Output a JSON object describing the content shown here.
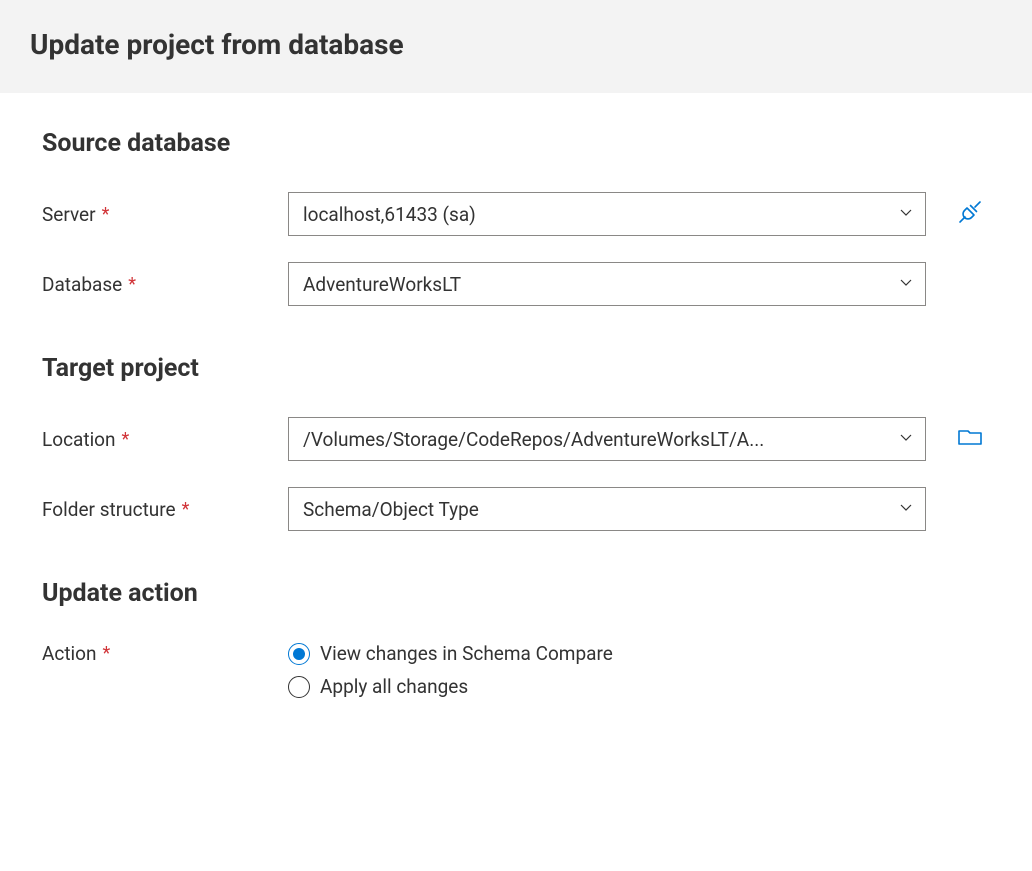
{
  "header": {
    "title": "Update project from database"
  },
  "source": {
    "title": "Source database",
    "server": {
      "label": "Server",
      "value": "localhost,61433 (sa)"
    },
    "database": {
      "label": "Database",
      "value": "AdventureWorksLT"
    }
  },
  "target": {
    "title": "Target project",
    "location": {
      "label": "Location",
      "value": "/Volumes/Storage/CodeRepos/AdventureWorksLT/A..."
    },
    "folder": {
      "label": "Folder structure",
      "value": "Schema/Object Type"
    }
  },
  "action": {
    "title": "Update action",
    "label": "Action",
    "options": {
      "view": "View changes in Schema Compare",
      "apply": "Apply all changes"
    },
    "selected": "view"
  }
}
